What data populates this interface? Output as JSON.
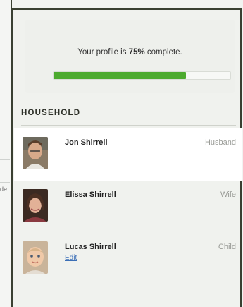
{
  "background": {
    "snippet": "de"
  },
  "profile": {
    "text_before": "Your profile is ",
    "percent_label": "75%",
    "text_after": " complete.",
    "completion_fraction": 0.75
  },
  "household": {
    "heading": "HOUSEHOLD",
    "members": [
      {
        "name": "Jon Shirrell",
        "role": "Husband",
        "edit": ""
      },
      {
        "name": "Elissa Shirrell",
        "role": "Wife",
        "edit": ""
      },
      {
        "name": "Lucas Shirrell",
        "role": "Child",
        "edit": "Edit"
      }
    ]
  },
  "colors": {
    "progress_fill": "#4caa2f",
    "panel_border": "#3a4032",
    "link": "#3b6fb6"
  }
}
